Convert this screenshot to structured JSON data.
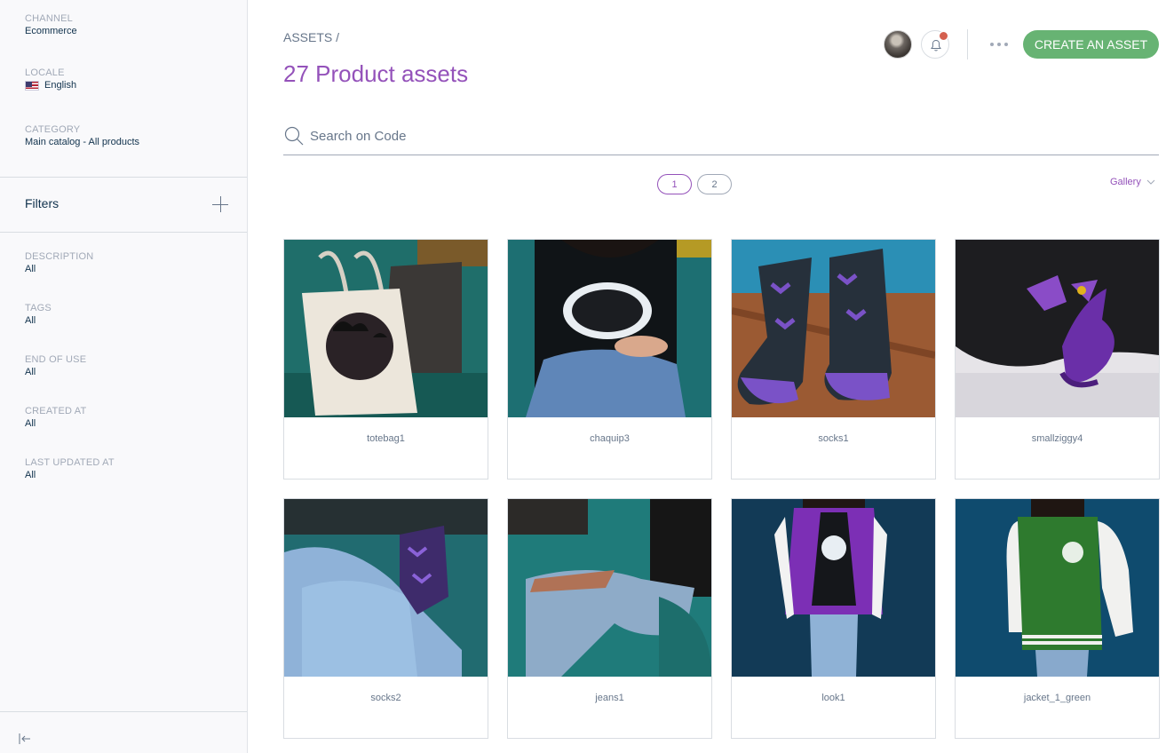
{
  "sidebar": {
    "channel": {
      "label": "CHANNEL",
      "value": "Ecommerce"
    },
    "locale": {
      "label": "LOCALE",
      "value": "English",
      "flag_icon": "us-flag-icon"
    },
    "category": {
      "label": "CATEGORY",
      "value": "Main catalog - All products"
    },
    "filters_title": "Filters",
    "filters": [
      {
        "label": "DESCRIPTION",
        "value": "All"
      },
      {
        "label": "TAGS",
        "value": "All"
      },
      {
        "label": "END OF USE",
        "value": "All"
      },
      {
        "label": "CREATED AT",
        "value": "All"
      },
      {
        "label": "LAST UPDATED AT",
        "value": "All"
      }
    ]
  },
  "header": {
    "breadcrumb": "ASSETS /",
    "title": "27 Product assets",
    "create_label": "CREATE AN ASSET",
    "accent_color": "#9452ba",
    "create_color": "#67b373",
    "notification_color": "#d4604f"
  },
  "search": {
    "placeholder": "Search on Code",
    "value": ""
  },
  "pagination": {
    "pages": [
      "1",
      "2"
    ],
    "current": "1"
  },
  "view": {
    "label": "Gallery"
  },
  "assets": [
    {
      "label": "totebag1"
    },
    {
      "label": "chaquip3"
    },
    {
      "label": "socks1"
    },
    {
      "label": "smallziggy4"
    },
    {
      "label": "socks2"
    },
    {
      "label": "jeans1"
    },
    {
      "label": "look1"
    },
    {
      "label": "jacket_1_green"
    }
  ]
}
